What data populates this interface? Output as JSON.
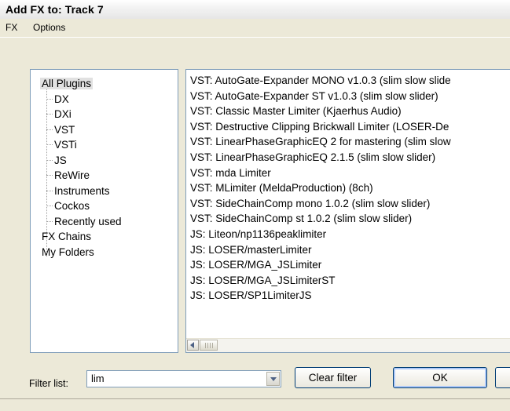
{
  "window": {
    "title": "Add FX to: Track 7"
  },
  "menu": [
    "FX",
    "Options"
  ],
  "categories": [
    {
      "label": "All Plugins",
      "selected": true,
      "indent": 0
    },
    {
      "label": "DX",
      "indent": 1
    },
    {
      "label": "DXi",
      "indent": 1
    },
    {
      "label": "VST",
      "indent": 1
    },
    {
      "label": "VSTi",
      "indent": 1
    },
    {
      "label": "JS",
      "indent": 1
    },
    {
      "label": "ReWire",
      "indent": 1
    },
    {
      "label": "Instruments",
      "indent": 1
    },
    {
      "label": "Cockos",
      "indent": 1
    },
    {
      "label": "Recently used",
      "indent": 1
    },
    {
      "label": "FX Chains",
      "indent": 0
    },
    {
      "label": "My Folders",
      "indent": 0
    }
  ],
  "fx_list": [
    "VST: AutoGate-Expander MONO v1.0.3 (slim slow slide",
    "VST: AutoGate-Expander ST v1.0.3 (slim slow slider)",
    "VST: Classic Master Limiter (Kjaerhus Audio)",
    "VST: Destructive Clipping Brickwall Limiter (LOSER-De",
    "VST: LinearPhaseGraphicEQ 2 for mastering (slim slow",
    "VST: LinearPhaseGraphicEQ 2.1.5 (slim slow slider)",
    "VST: mda Limiter",
    "VST: MLimiter (MeldaProduction) (8ch)",
    "VST: SideChainComp mono 1.0.2 (slim slow slider)",
    "VST: SideChainComp st 1.0.2 (slim slow slider)",
    "JS: Liteon/np1136peaklimiter",
    "JS: LOSER/masterLimiter",
    "JS: LOSER/MGA_JSLimiter",
    "JS: LOSER/MGA_JSLimiterST",
    "JS: LOSER/SP1LimiterJS"
  ],
  "filter": {
    "label": "Filter list:",
    "value": "lim"
  },
  "buttons": {
    "clear_filter": "Clear filter",
    "ok": "OK"
  }
}
